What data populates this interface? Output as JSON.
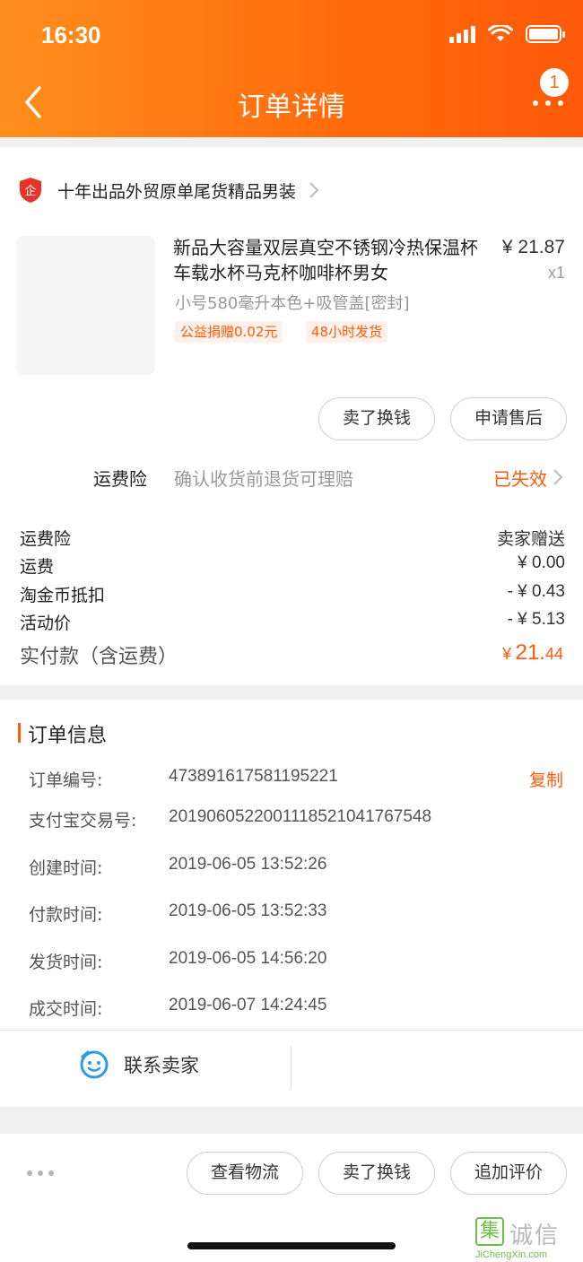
{
  "status_bar": {
    "time": "16:30"
  },
  "header": {
    "title": "订单详情",
    "badge": "1"
  },
  "store": {
    "name": "十年出品外贸原单尾货精品男装"
  },
  "product": {
    "title": "新品大容量双层真空不锈钢冷热保温杯车载水杯马克杯咖啡杯男女",
    "price": "¥ 21.87",
    "quantity": "x1",
    "spec": "小号580毫升本色+吸管盖[密封]",
    "tags": [
      "公益捐赠0.02元",
      "48小时发货"
    ],
    "actions": [
      "卖了换钱",
      "申请售后"
    ]
  },
  "insurance": {
    "label": "运费险",
    "desc": "确认收货前退货可理赔",
    "status": "已失效"
  },
  "fees": [
    {
      "label": "运费险",
      "value": "卖家赠送"
    },
    {
      "label": "运费",
      "value": "¥ 0.00"
    },
    {
      "label": "淘金币抵扣",
      "value": "- ¥ 0.43"
    },
    {
      "label": "活动价",
      "value": "- ¥ 5.13"
    }
  ],
  "paid": {
    "label": "实付款（含运费）",
    "currency": "¥",
    "integer": "21.",
    "decimal": "44"
  },
  "order_info": {
    "title": "订单信息",
    "copy_label": "复制",
    "rows": [
      {
        "label": "订单编号:",
        "value": "473891617581195221"
      },
      {
        "label": "支付宝交易号:",
        "value": "2019060522001118521041767548"
      },
      {
        "label": "创建时间:",
        "value": "2019-06-05 13:52:26"
      },
      {
        "label": "付款时间:",
        "value": "2019-06-05 13:52:33"
      },
      {
        "label": "发货时间:",
        "value": "2019-06-05 14:56:20"
      },
      {
        "label": "成交时间:",
        "value": "2019-06-07 14:24:45"
      }
    ]
  },
  "contact": {
    "label": "联系卖家"
  },
  "bottom_actions": [
    "查看物流",
    "卖了换钱",
    "追加评价"
  ],
  "watermark": {
    "glyph": "集",
    "text": "诚信",
    "sub": "JiChengXin.com"
  },
  "colors": {
    "accent": "#ff5a0a",
    "header_start": "#ff8f1c",
    "header_end": "#ff5a0a"
  }
}
